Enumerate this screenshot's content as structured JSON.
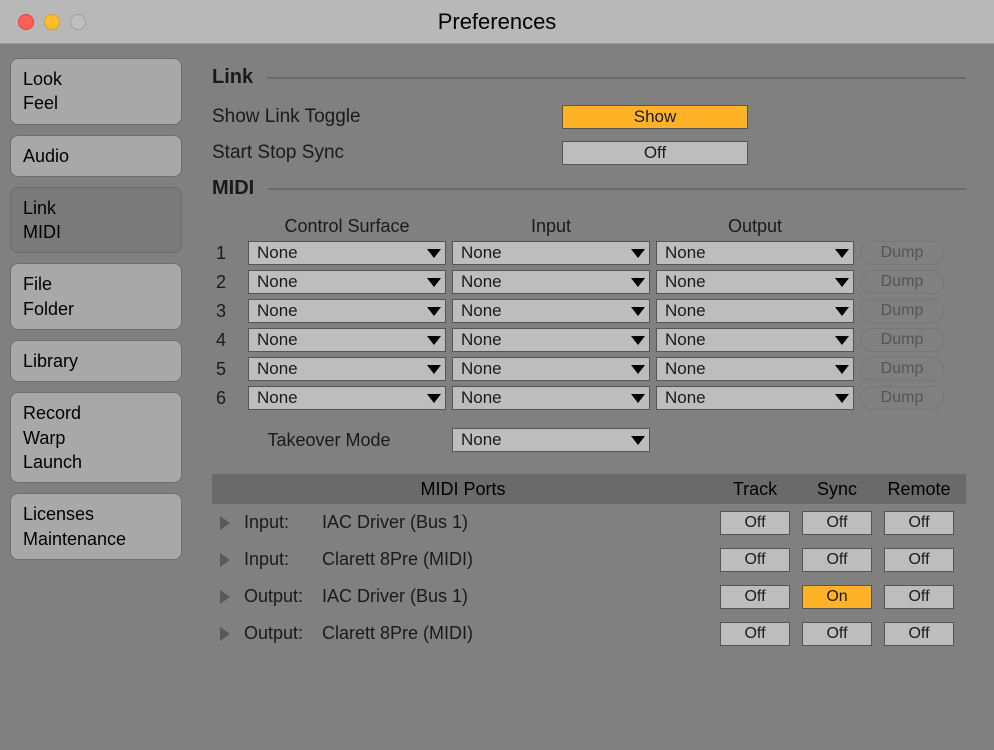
{
  "window": {
    "title": "Preferences"
  },
  "sidebar": {
    "items": [
      {
        "line1": "Look",
        "line2": "Feel",
        "active": false
      },
      {
        "line1": "Audio",
        "line2": "",
        "active": false
      },
      {
        "line1": "Link",
        "line2": "MIDI",
        "active": true
      },
      {
        "line1": "File",
        "line2": "Folder",
        "active": false
      },
      {
        "line1": "Library",
        "line2": "",
        "active": false
      },
      {
        "line1": "Record",
        "line2": "Warp",
        "line3": "Launch",
        "active": false
      },
      {
        "line1": "Licenses",
        "line2": "Maintenance",
        "active": false
      }
    ]
  },
  "sections": {
    "link": "Link",
    "midi": "MIDI"
  },
  "link": {
    "showLinkToggle": {
      "label": "Show Link Toggle",
      "value": "Show",
      "on": true
    },
    "startStopSync": {
      "label": "Start Stop Sync",
      "value": "Off",
      "on": false
    }
  },
  "controlSurface": {
    "headers": {
      "cs": "Control Surface",
      "input": "Input",
      "output": "Output"
    },
    "dumpLabel": "Dump",
    "rows": [
      {
        "n": "1",
        "cs": "None",
        "in": "None",
        "out": "None"
      },
      {
        "n": "2",
        "cs": "None",
        "in": "None",
        "out": "None"
      },
      {
        "n": "3",
        "cs": "None",
        "in": "None",
        "out": "None"
      },
      {
        "n": "4",
        "cs": "None",
        "in": "None",
        "out": "None"
      },
      {
        "n": "5",
        "cs": "None",
        "in": "None",
        "out": "None"
      },
      {
        "n": "6",
        "cs": "None",
        "in": "None",
        "out": "None"
      }
    ],
    "takeover": {
      "label": "Takeover Mode",
      "value": "None"
    }
  },
  "ports": {
    "headers": {
      "title": "MIDI Ports",
      "track": "Track",
      "sync": "Sync",
      "remote": "Remote"
    },
    "rows": [
      {
        "dir": "Input:",
        "name": "IAC Driver (Bus 1)",
        "track": "Off",
        "sync": "Off",
        "remote": "Off",
        "syncOn": false
      },
      {
        "dir": "Input:",
        "name": "Clarett 8Pre (MIDI)",
        "track": "Off",
        "sync": "Off",
        "remote": "Off",
        "syncOn": false
      },
      {
        "dir": "Output:",
        "name": "IAC Driver (Bus 1)",
        "track": "Off",
        "sync": "On",
        "remote": "Off",
        "syncOn": true
      },
      {
        "dir": "Output:",
        "name": "Clarett 8Pre (MIDI)",
        "track": "Off",
        "sync": "Off",
        "remote": "Off",
        "syncOn": false
      }
    ]
  }
}
